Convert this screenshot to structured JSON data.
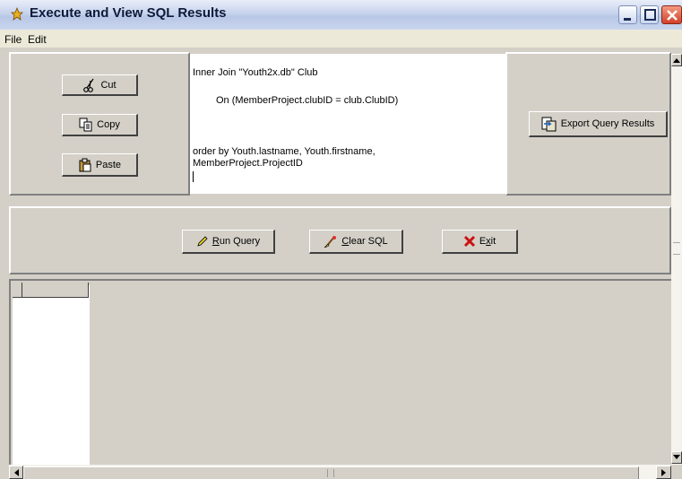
{
  "window": {
    "title": "Execute and View SQL Results",
    "icon": "app-icon"
  },
  "menu": {
    "items": [
      "File",
      "Edit"
    ]
  },
  "clipboard": {
    "cut_label": "Cut",
    "copy_label": "Copy",
    "paste_label": "Paste"
  },
  "editor": {
    "lines": [
      "Inner Join \"Youth2x.db\" Club",
      "On (MemberProject.clubID = club.ClubID)",
      "order by Youth.lastname, Youth.firstname,",
      "MemberProject.ProjectID"
    ]
  },
  "export": {
    "label": "Export Query Results"
  },
  "actions": {
    "run_pre": "",
    "run_access": "R",
    "run_post": "un Query",
    "clear_pre": "",
    "clear_access": "C",
    "clear_post": "lear SQL",
    "exit_pre": "E",
    "exit_access": "x",
    "exit_post": "it"
  },
  "colors": {
    "face": "#d4d0c8",
    "exit_x": "#cc1010"
  }
}
